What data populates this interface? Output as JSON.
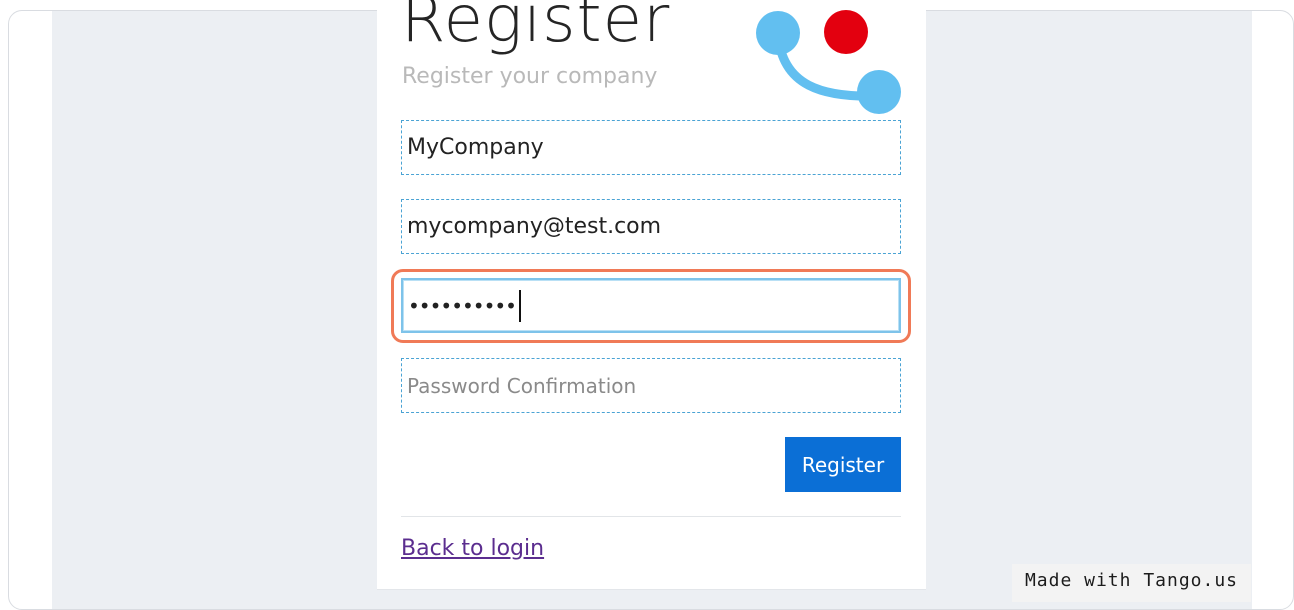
{
  "form": {
    "title": "Register",
    "subtitle": "Register your company",
    "company_name_value": "MyCompany",
    "email_value": "mycompany@test.com",
    "password_value": "••••••••••",
    "password_confirmation_placeholder": "Password Confirmation",
    "register_label": "Register",
    "back_to_login_label": "Back to login"
  },
  "colors": {
    "accent_blue": "#0b6fd6",
    "logo_light_blue": "#62bff0",
    "logo_red": "#e3000f",
    "highlight_orange": "#f07a57",
    "link_purple": "#5b2d8f"
  },
  "watermark": {
    "text": "Made with Tango.us"
  }
}
